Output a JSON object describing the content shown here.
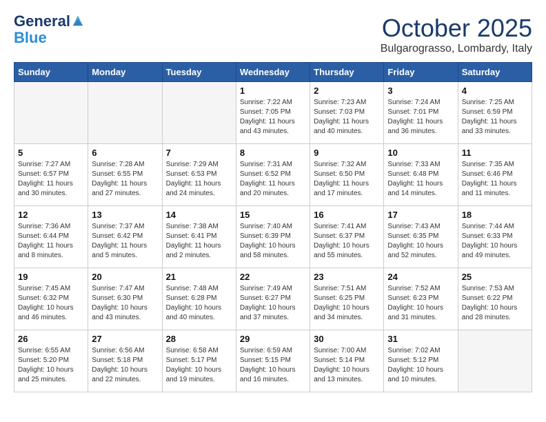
{
  "header": {
    "logo_line1": "General",
    "logo_line2": "Blue",
    "month": "October 2025",
    "location": "Bulgarograsso, Lombardy, Italy"
  },
  "days_of_week": [
    "Sunday",
    "Monday",
    "Tuesday",
    "Wednesday",
    "Thursday",
    "Friday",
    "Saturday"
  ],
  "weeks": [
    [
      {
        "day": "",
        "info": "",
        "empty": true
      },
      {
        "day": "",
        "info": "",
        "empty": true
      },
      {
        "day": "",
        "info": "",
        "empty": true
      },
      {
        "day": "1",
        "info": "Sunrise: 7:22 AM\nSunset: 7:05 PM\nDaylight: 11 hours\nand 43 minutes."
      },
      {
        "day": "2",
        "info": "Sunrise: 7:23 AM\nSunset: 7:03 PM\nDaylight: 11 hours\nand 40 minutes."
      },
      {
        "day": "3",
        "info": "Sunrise: 7:24 AM\nSunset: 7:01 PM\nDaylight: 11 hours\nand 36 minutes."
      },
      {
        "day": "4",
        "info": "Sunrise: 7:25 AM\nSunset: 6:59 PM\nDaylight: 11 hours\nand 33 minutes."
      }
    ],
    [
      {
        "day": "5",
        "info": "Sunrise: 7:27 AM\nSunset: 6:57 PM\nDaylight: 11 hours\nand 30 minutes."
      },
      {
        "day": "6",
        "info": "Sunrise: 7:28 AM\nSunset: 6:55 PM\nDaylight: 11 hours\nand 27 minutes."
      },
      {
        "day": "7",
        "info": "Sunrise: 7:29 AM\nSunset: 6:53 PM\nDaylight: 11 hours\nand 24 minutes."
      },
      {
        "day": "8",
        "info": "Sunrise: 7:31 AM\nSunset: 6:52 PM\nDaylight: 11 hours\nand 20 minutes."
      },
      {
        "day": "9",
        "info": "Sunrise: 7:32 AM\nSunset: 6:50 PM\nDaylight: 11 hours\nand 17 minutes."
      },
      {
        "day": "10",
        "info": "Sunrise: 7:33 AM\nSunset: 6:48 PM\nDaylight: 11 hours\nand 14 minutes."
      },
      {
        "day": "11",
        "info": "Sunrise: 7:35 AM\nSunset: 6:46 PM\nDaylight: 11 hours\nand 11 minutes."
      }
    ],
    [
      {
        "day": "12",
        "info": "Sunrise: 7:36 AM\nSunset: 6:44 PM\nDaylight: 11 hours\nand 8 minutes."
      },
      {
        "day": "13",
        "info": "Sunrise: 7:37 AM\nSunset: 6:42 PM\nDaylight: 11 hours\nand 5 minutes."
      },
      {
        "day": "14",
        "info": "Sunrise: 7:38 AM\nSunset: 6:41 PM\nDaylight: 11 hours\nand 2 minutes."
      },
      {
        "day": "15",
        "info": "Sunrise: 7:40 AM\nSunset: 6:39 PM\nDaylight: 10 hours\nand 58 minutes."
      },
      {
        "day": "16",
        "info": "Sunrise: 7:41 AM\nSunset: 6:37 PM\nDaylight: 10 hours\nand 55 minutes."
      },
      {
        "day": "17",
        "info": "Sunrise: 7:43 AM\nSunset: 6:35 PM\nDaylight: 10 hours\nand 52 minutes."
      },
      {
        "day": "18",
        "info": "Sunrise: 7:44 AM\nSunset: 6:33 PM\nDaylight: 10 hours\nand 49 minutes."
      }
    ],
    [
      {
        "day": "19",
        "info": "Sunrise: 7:45 AM\nSunset: 6:32 PM\nDaylight: 10 hours\nand 46 minutes."
      },
      {
        "day": "20",
        "info": "Sunrise: 7:47 AM\nSunset: 6:30 PM\nDaylight: 10 hours\nand 43 minutes."
      },
      {
        "day": "21",
        "info": "Sunrise: 7:48 AM\nSunset: 6:28 PM\nDaylight: 10 hours\nand 40 minutes."
      },
      {
        "day": "22",
        "info": "Sunrise: 7:49 AM\nSunset: 6:27 PM\nDaylight: 10 hours\nand 37 minutes."
      },
      {
        "day": "23",
        "info": "Sunrise: 7:51 AM\nSunset: 6:25 PM\nDaylight: 10 hours\nand 34 minutes."
      },
      {
        "day": "24",
        "info": "Sunrise: 7:52 AM\nSunset: 6:23 PM\nDaylight: 10 hours\nand 31 minutes."
      },
      {
        "day": "25",
        "info": "Sunrise: 7:53 AM\nSunset: 6:22 PM\nDaylight: 10 hours\nand 28 minutes."
      }
    ],
    [
      {
        "day": "26",
        "info": "Sunrise: 6:55 AM\nSunset: 5:20 PM\nDaylight: 10 hours\nand 25 minutes."
      },
      {
        "day": "27",
        "info": "Sunrise: 6:56 AM\nSunset: 5:18 PM\nDaylight: 10 hours\nand 22 minutes."
      },
      {
        "day": "28",
        "info": "Sunrise: 6:58 AM\nSunset: 5:17 PM\nDaylight: 10 hours\nand 19 minutes."
      },
      {
        "day": "29",
        "info": "Sunrise: 6:59 AM\nSunset: 5:15 PM\nDaylight: 10 hours\nand 16 minutes."
      },
      {
        "day": "30",
        "info": "Sunrise: 7:00 AM\nSunset: 5:14 PM\nDaylight: 10 hours\nand 13 minutes."
      },
      {
        "day": "31",
        "info": "Sunrise: 7:02 AM\nSunset: 5:12 PM\nDaylight: 10 hours\nand 10 minutes."
      },
      {
        "day": "",
        "info": "",
        "empty": true
      }
    ]
  ]
}
